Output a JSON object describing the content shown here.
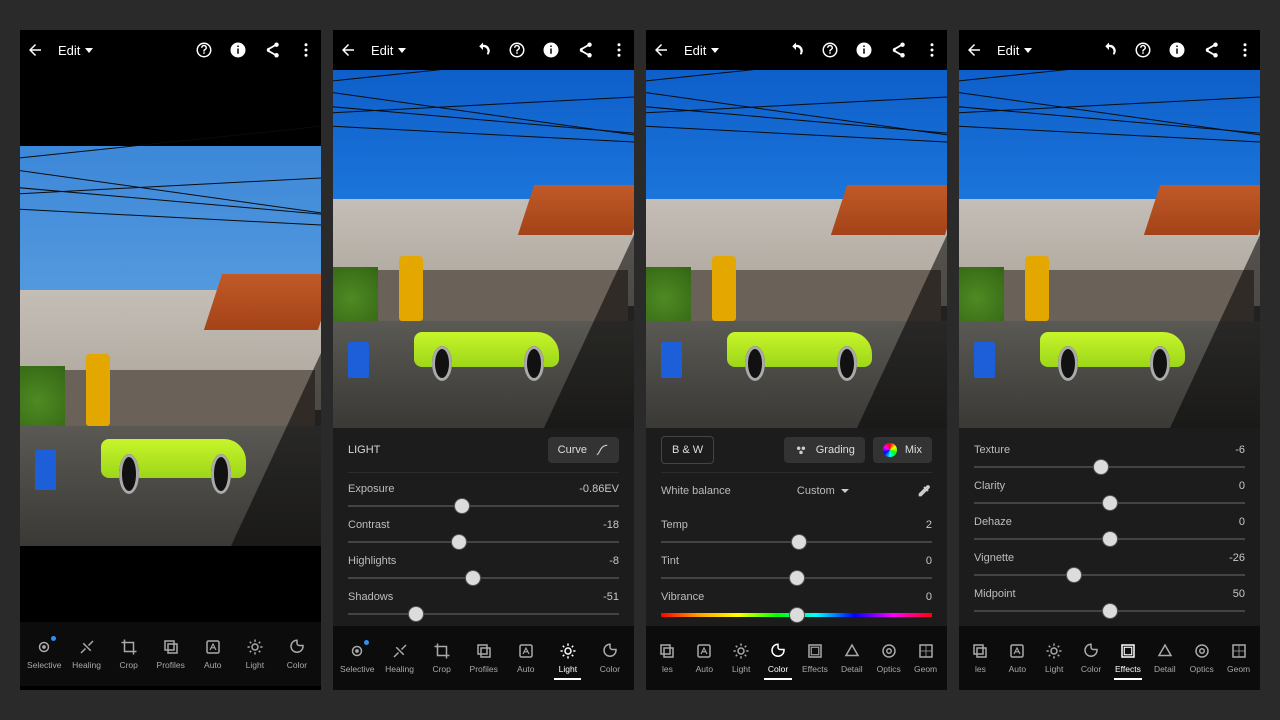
{
  "edit_label": "Edit",
  "panels": {
    "light": {
      "title": "LIGHT",
      "curve_label": "Curve",
      "sliders": [
        {
          "label": "Exposure",
          "value": "-0.86EV",
          "pos": 42
        },
        {
          "label": "Contrast",
          "value": "-18",
          "pos": 41
        },
        {
          "label": "Highlights",
          "value": "-8",
          "pos": 46
        },
        {
          "label": "Shadows",
          "value": "-51",
          "pos": 25
        }
      ]
    },
    "color": {
      "bw_label": "B & W",
      "grading_label": "Grading",
      "mix_label": "Mix",
      "wb_label": "White balance",
      "wb_value": "Custom",
      "sliders": [
        {
          "label": "Temp",
          "value": "2",
          "pos": 51
        },
        {
          "label": "Tint",
          "value": "0",
          "pos": 50
        },
        {
          "label": "Vibrance",
          "value": "0",
          "pos": 50,
          "rainbow": true
        }
      ]
    },
    "effects": {
      "sliders": [
        {
          "label": "Texture",
          "value": "-6",
          "pos": 47
        },
        {
          "label": "Clarity",
          "value": "0",
          "pos": 50
        },
        {
          "label": "Dehaze",
          "value": "0",
          "pos": 50
        },
        {
          "label": "Vignette",
          "value": "-26",
          "pos": 37
        },
        {
          "label": "Midpoint",
          "value": "50",
          "pos": 50
        }
      ]
    }
  },
  "tools": {
    "set_a": [
      {
        "label": "Selective",
        "icon": "selective",
        "dot": true
      },
      {
        "label": "Healing",
        "icon": "healing"
      },
      {
        "label": "Crop",
        "icon": "crop"
      },
      {
        "label": "Profiles",
        "icon": "profiles"
      },
      {
        "label": "Auto",
        "icon": "auto"
      },
      {
        "label": "Light",
        "icon": "light"
      },
      {
        "label": "Color",
        "icon": "color"
      }
    ],
    "set_b": [
      {
        "label": "les",
        "icon": "profiles"
      },
      {
        "label": "Auto",
        "icon": "auto"
      },
      {
        "label": "Light",
        "icon": "light"
      },
      {
        "label": "Color",
        "icon": "color"
      },
      {
        "label": "Effects",
        "icon": "effects"
      },
      {
        "label": "Detail",
        "icon": "detail"
      },
      {
        "label": "Optics",
        "icon": "optics"
      },
      {
        "label": "Geom",
        "icon": "geom"
      }
    ]
  }
}
